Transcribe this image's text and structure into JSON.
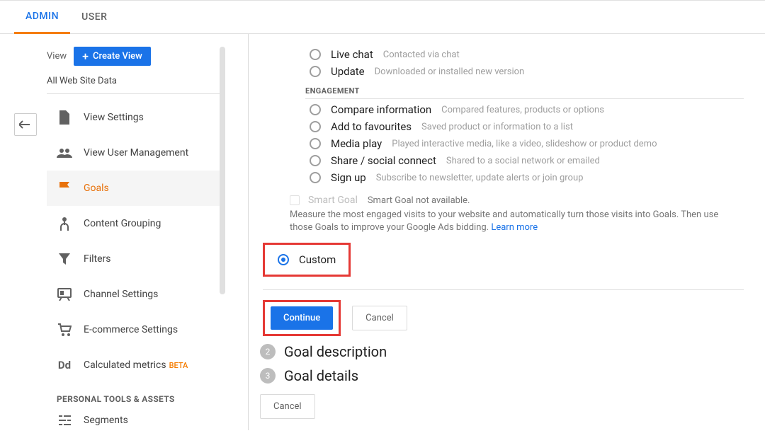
{
  "topbar": {
    "admin": "ADMIN",
    "user": "USER"
  },
  "sidebar": {
    "view_label": "View",
    "create_view": "Create View",
    "all_data": "All Web Site Data",
    "items": [
      {
        "label": "View Settings"
      },
      {
        "label": "View User Management"
      },
      {
        "label": "Goals"
      },
      {
        "label": "Content Grouping"
      },
      {
        "label": "Filters"
      },
      {
        "label": "Channel Settings"
      },
      {
        "label": "E-commerce Settings"
      },
      {
        "label": "Calculated metrics"
      }
    ],
    "beta": "BETA",
    "section_personal": "PERSONAL TOOLS & ASSETS",
    "segments": "Segments"
  },
  "goal_templates": {
    "live_chat": {
      "label": "Live chat",
      "desc": "Contacted via chat"
    },
    "update": {
      "label": "Update",
      "desc": "Downloaded or installed new version"
    },
    "engagement_head": "ENGAGEMENT",
    "compare": {
      "label": "Compare information",
      "desc": "Compared features, products or options"
    },
    "favourites": {
      "label": "Add to favourites",
      "desc": "Saved product or information to a list"
    },
    "media": {
      "label": "Media play",
      "desc": "Played interactive media, like a video, slideshow or product demo"
    },
    "social": {
      "label": "Share / social connect",
      "desc": "Shared to a social network or emailed"
    },
    "signup": {
      "label": "Sign up",
      "desc": "Subscribe to newsletter, update alerts or join group"
    }
  },
  "smart_goal": {
    "title": "Smart Goal",
    "na": "Smart Goal not available.",
    "desc": "Measure the most engaged visits to your website and automatically turn those visits into Goals. Then use those Goals to improve your Google Ads bidding. ",
    "learn_more": "Learn more"
  },
  "custom": {
    "label": "Custom"
  },
  "buttons": {
    "continue": "Continue",
    "cancel": "Cancel"
  },
  "steps": {
    "desc": {
      "num": "2",
      "title": "Goal description"
    },
    "details": {
      "num": "3",
      "title": "Goal details"
    }
  },
  "cancel_bottom": "Cancel"
}
